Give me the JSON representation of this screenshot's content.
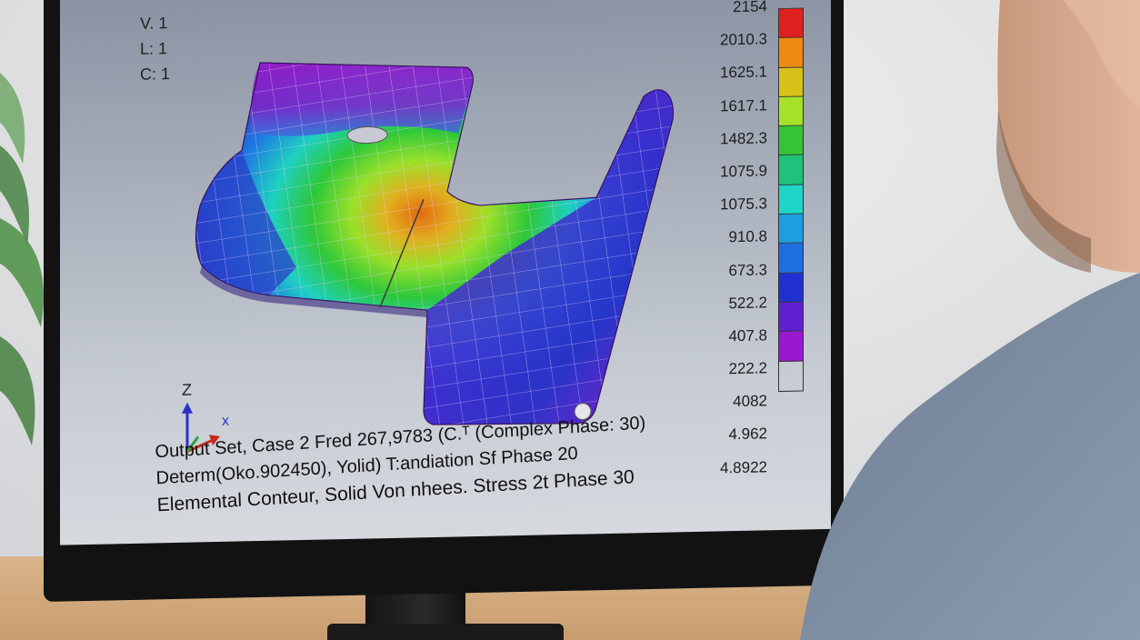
{
  "hud": {
    "v": "V. 1",
    "l": "L: 1",
    "c": "C: 1"
  },
  "legend": {
    "values": [
      "2154",
      "2010.3",
      "1625.1",
      "1617.1",
      "1482.3",
      "1075.9",
      "1075.3",
      "910.8",
      "673.3",
      "522.2",
      "407.8",
      "222.2",
      "4082",
      "4.962",
      "4.8922"
    ],
    "colors": [
      "#e02020",
      "#ee8a10",
      "#d6c21a",
      "#a6e22a",
      "#36c436",
      "#1ec27a",
      "#1ed6c8",
      "#1e9ee0",
      "#1e6ee0",
      "#2030d0",
      "#6020d0",
      "#9a18d0"
    ]
  },
  "triad": {
    "z_label": "Z",
    "x_label": "x"
  },
  "caption": {
    "line1": "Output Set, Case 2 Fred 267,9783 (C.ᵀ (Complex Phase: 30)",
    "line2": "Determ(Oko.902450), Yolid) T:andiation Sf Phase 20",
    "line3": "Elemental Conteur, Solid Von nhees. Stress 2t Phase 30"
  }
}
